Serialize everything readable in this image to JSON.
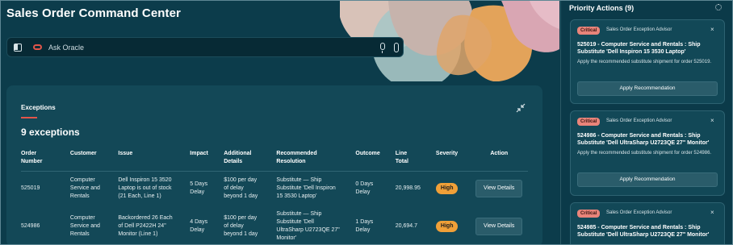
{
  "app": {
    "title": "Sales Order Command Center"
  },
  "search": {
    "placeholder": "Ask Oracle"
  },
  "exceptions": {
    "title": "Exceptions",
    "count_label": "9 exceptions",
    "columns": [
      "Order Number",
      "Customer",
      "Issue",
      "Impact",
      "Additional Details",
      "Recommended Resolution",
      "Outcome",
      "Line Total",
      "Severity",
      "Action"
    ],
    "rows": [
      {
        "order": "525019",
        "customer": "Computer Service and Rentals",
        "issue": "Dell Inspiron 15 3520 Laptop is out of stock (21 Each, Line 1)",
        "impact": "5 Days Delay",
        "details": "$100 per day of delay beyond 1 day",
        "resolution": "Substitute — Ship Substitute 'Dell Inspiron 15 3530 Laptop'",
        "outcome": "0 Days Delay",
        "line_total": "20,998.95",
        "severity": "High",
        "action": "View Details"
      },
      {
        "order": "524986",
        "customer": "Computer Service and Rentals",
        "issue": "Backordered 26 Each of Dell P2422H 24\" Monitor (Line 1)",
        "impact": "4 Days Delay",
        "details": "$100 per day of delay beyond 1 day",
        "resolution": "Substitute — Ship Substitute 'Dell UltraSharp U2723QE 27\" Monitor'",
        "outcome": "1 Days Delay",
        "line_total": "20,694.7",
        "severity": "High",
        "action": "View Details"
      }
    ]
  },
  "priority": {
    "title": "Priority Actions (9)",
    "cards": [
      {
        "badge": "Critical",
        "advisor": "Sales Order Exception Advisor",
        "close": "×",
        "title": "525019 - Computer Service and Rentals : Ship Substitute 'Dell Inspiron 15 3530 Laptop'",
        "description": "Apply the recommended substitute shipment for order 525019.",
        "button": "Apply Recommendation"
      },
      {
        "badge": "Critical",
        "advisor": "Sales Order Exception Advisor",
        "close": "×",
        "title": "524986 - Computer Service and Rentals : Ship Substitute 'Dell UltraSharp U2723QE 27\" Monitor'",
        "description": "Apply the recommended substitute shipment for order 524986.",
        "button": "Apply Recommendation"
      },
      {
        "badge": "Critical",
        "advisor": "Sales Order Exception Advisor",
        "close": "×",
        "title": "524985 - Computer Service and Rentals : Ship Substitute 'Dell UltraSharp U2723QE 27\" Monitor'",
        "description": "",
        "button": ""
      }
    ]
  },
  "colors": {
    "background": "#0c3c4b",
    "panel": "#134857",
    "accent_red": "#e2554a",
    "severity_high": "#f0a038",
    "critical_badge": "#e9847a"
  },
  "icons": [
    "sidebar-toggle-icon",
    "oracle-logo-icon",
    "microphone-icon",
    "attachment-icon",
    "collapse-icon",
    "gear-icon",
    "close-icon"
  ]
}
